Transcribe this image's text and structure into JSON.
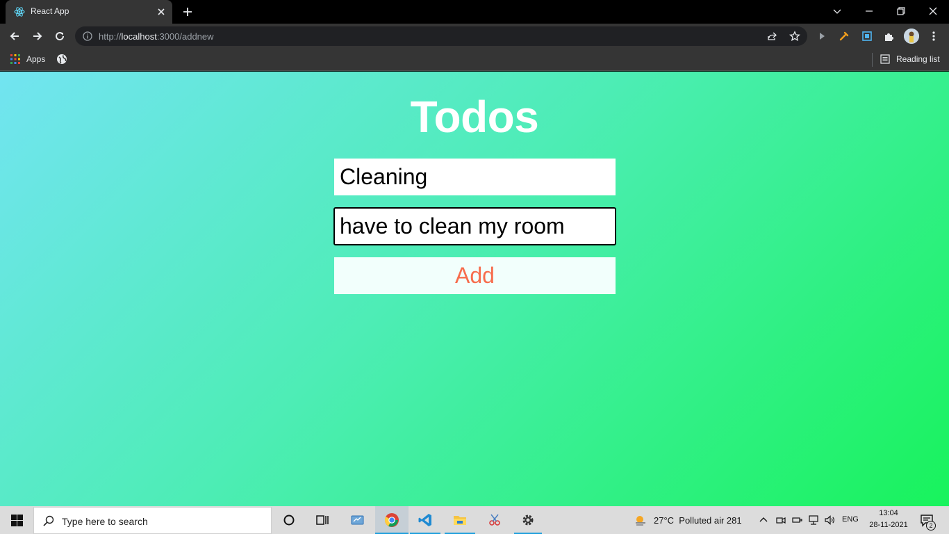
{
  "browser": {
    "tab": {
      "title": "React App"
    },
    "address": {
      "scheme": "http://",
      "host": "localhost",
      "rest": ":3000/addnew"
    },
    "bookmarks": {
      "apps_label": "Apps",
      "reading_list_label": "Reading list"
    }
  },
  "page": {
    "heading": "Todos",
    "title_input": {
      "value": "Cleaning"
    },
    "description_input": {
      "value": "have to clean my room"
    },
    "add_button": {
      "label": "Add"
    },
    "colors": {
      "gradient_start": "#72e4f1",
      "gradient_end": "#18f35c",
      "button_text": "#f76d4d",
      "button_bg": "#f2fffc"
    }
  },
  "taskbar": {
    "search_placeholder": "Type here to search",
    "weather": {
      "temp": "27°C",
      "condition": "Polluted air 281"
    },
    "language": "ENG",
    "time": "13:04",
    "date": "28-11-2021",
    "notification_count": "2",
    "pinned": [
      "cortana-icon",
      "task-view-icon",
      "window-app-icon",
      "chrome-icon",
      "vscode-icon",
      "file-explorer-icon",
      "snipping-tool-icon",
      "settings-icon"
    ]
  }
}
